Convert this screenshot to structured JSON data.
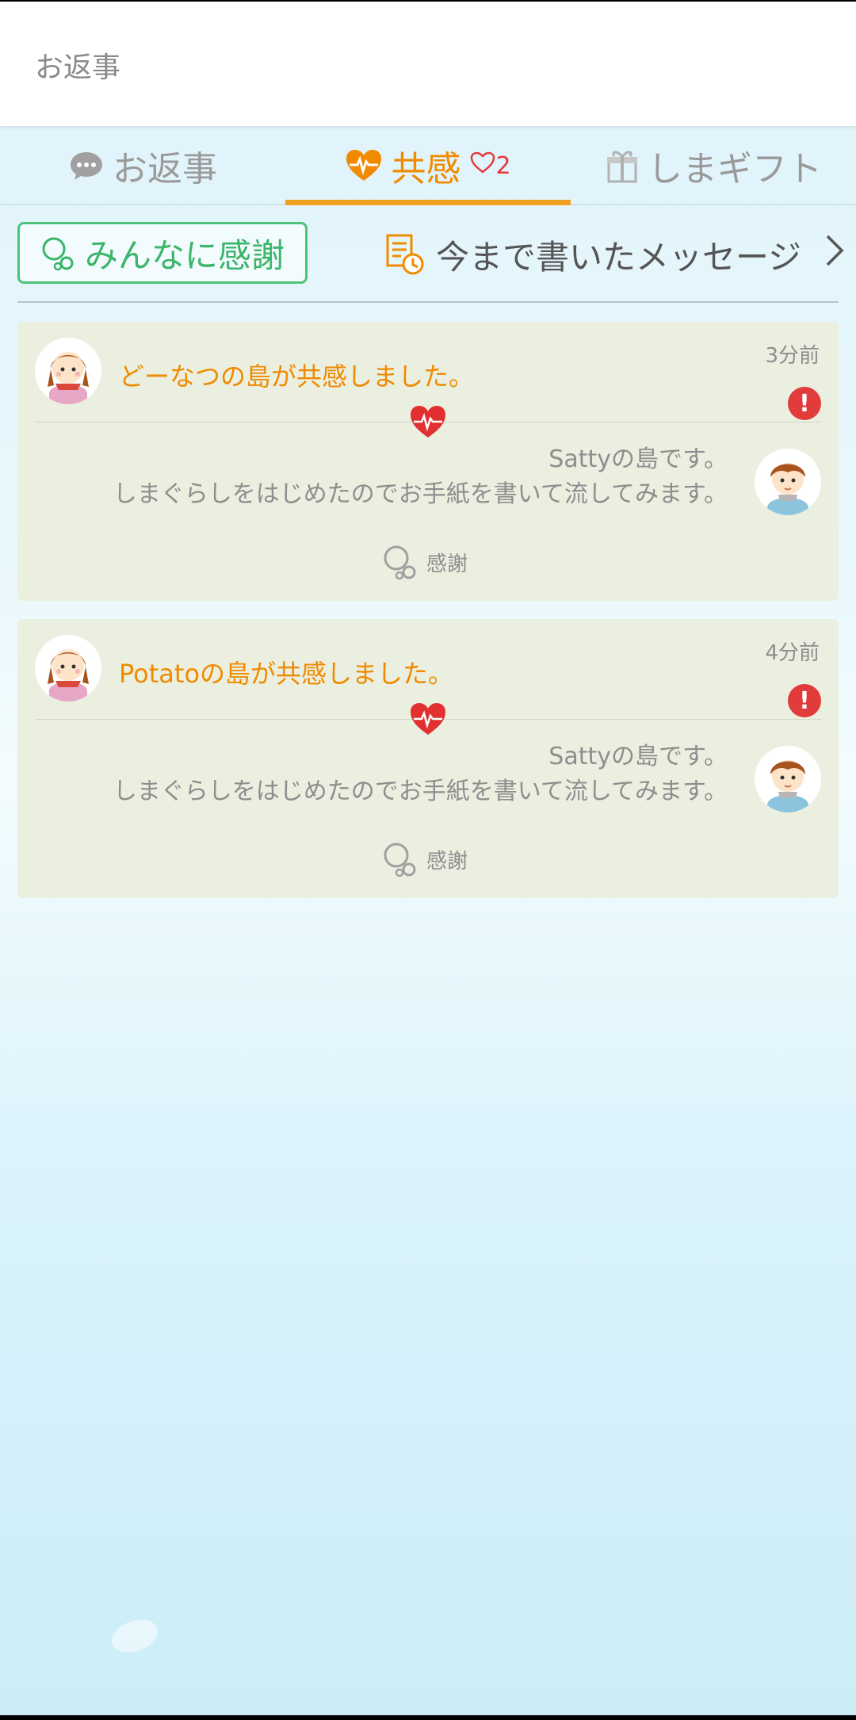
{
  "header": {
    "title": "お返事"
  },
  "tabs": [
    {
      "label": "お返事",
      "icon": "chat-bubble-icon"
    },
    {
      "label": "共感",
      "icon": "heartbeat-icon",
      "badge_count": "2"
    },
    {
      "label": "しまギフト",
      "icon": "gift-icon"
    }
  ],
  "actions": {
    "thanks_all_label": "みんなに感謝",
    "past_messages_label": "今まで書いたメッセージ"
  },
  "cards": [
    {
      "sender_text": "どーなつの島が共感しました。",
      "time": "3分前",
      "message_line1": "Sattyの島です。",
      "message_line2": "しまぐらしをはじめたのでお手紙を書いて流してみます。",
      "thank_label": "感謝"
    },
    {
      "sender_text": "Potatoの島が共感しました。",
      "time": "4分前",
      "message_line1": "Sattyの島です。",
      "message_line2": "しまぐらしをはじめたのでお手紙を書いて流してみます。",
      "thank_label": "感謝"
    }
  ],
  "colors": {
    "accent_orange": "#f08a00",
    "green": "#3bb56a",
    "alert_red": "#e23b3b"
  }
}
